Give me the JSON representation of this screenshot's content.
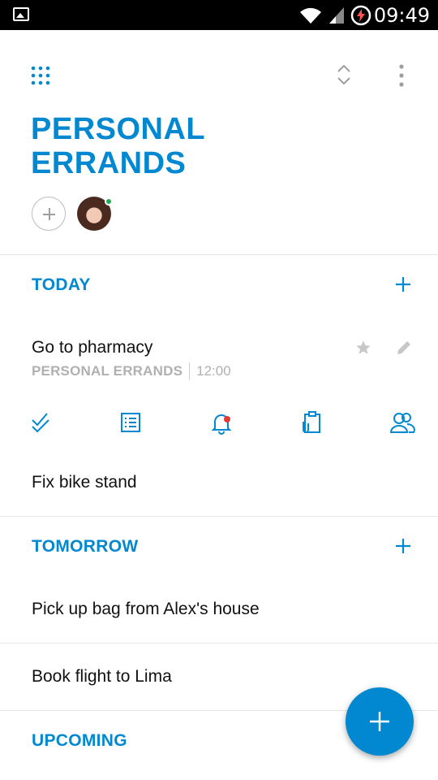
{
  "status_bar": {
    "time": "09:49"
  },
  "list": {
    "title": "PERSONAL ERRANDS"
  },
  "sections": {
    "today": {
      "label": "TODAY",
      "tasks": [
        {
          "title": "Go to pharmacy",
          "list_name": "PERSONAL ERRANDS",
          "time": "12:00"
        },
        {
          "title": "Fix bike stand"
        }
      ]
    },
    "tomorrow": {
      "label": "TOMORROW",
      "tasks": [
        {
          "title": "Pick up bag from Alex's house"
        },
        {
          "title": "Book flight to Lima"
        }
      ]
    },
    "upcoming": {
      "label": "UPCOMING"
    }
  },
  "colors": {
    "accent": "#0288d1",
    "online": "#1faa55",
    "reminder_dot": "#e53935",
    "muted": "#b0b0b0"
  },
  "icons": {
    "top_left": "apps-grid-icon",
    "top_sort": "sort-icon",
    "top_more": "more-vertical-icon",
    "task_actions": [
      "check-icon",
      "checklist-icon",
      "reminder-bell-icon",
      "attachment-clipboard-icon",
      "share-people-icon"
    ]
  }
}
